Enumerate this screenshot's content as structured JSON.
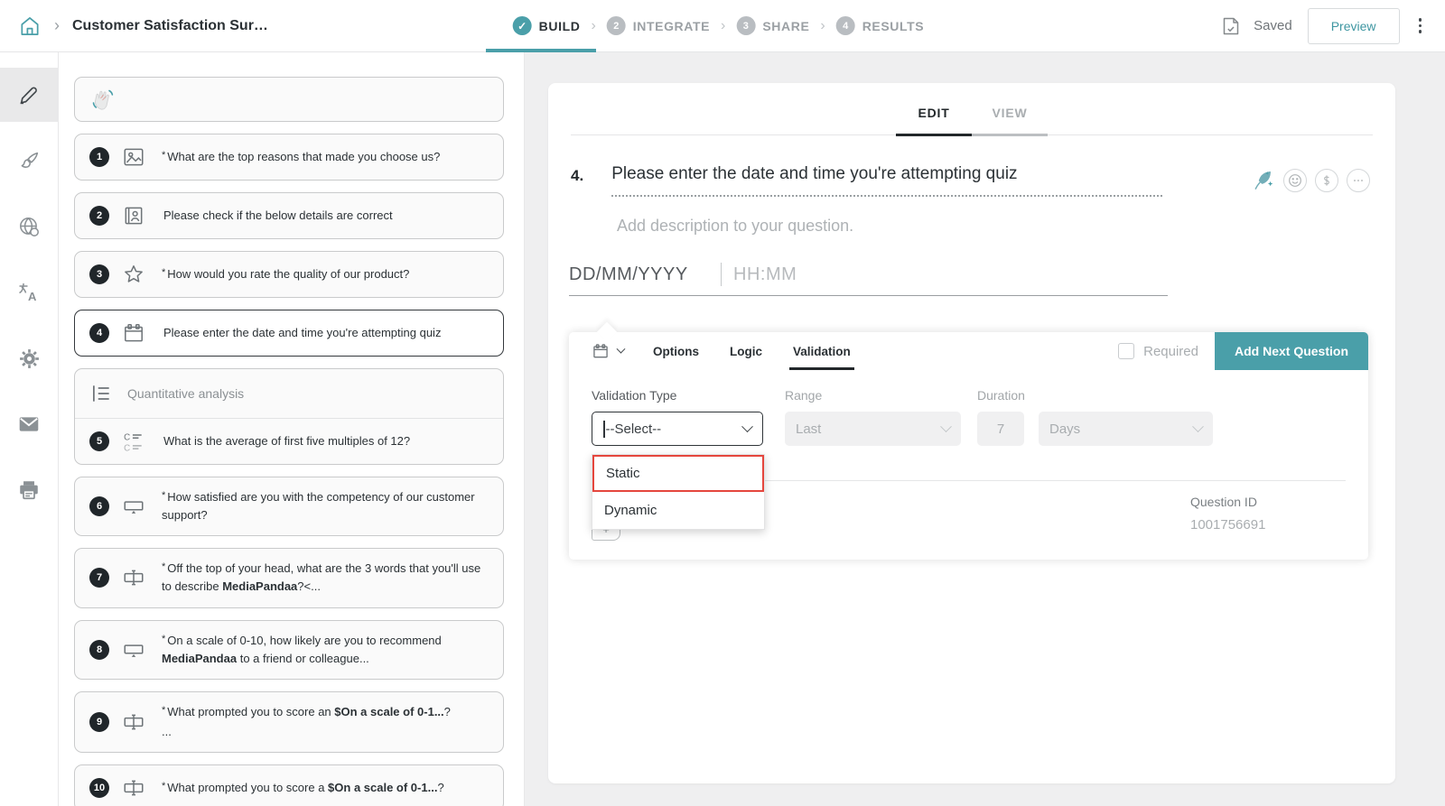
{
  "colors": {
    "accent": "#4A9FA9",
    "highlight_red": "#E5463D",
    "badge_dark": "#20262A"
  },
  "header": {
    "title": "Customer Satisfaction Sur…",
    "steps": [
      {
        "label": "BUILD",
        "state": "done",
        "icon": "check-icon"
      },
      {
        "num": "2",
        "label": "INTEGRATE"
      },
      {
        "num": "3",
        "label": "SHARE"
      },
      {
        "num": "4",
        "label": "RESULTS"
      }
    ],
    "saved_label": "Saved",
    "preview_label": "Preview"
  },
  "rail": {
    "items": [
      {
        "icon": "pencil-icon",
        "active": true
      },
      {
        "icon": "brush-icon"
      },
      {
        "icon": "globe-icon"
      },
      {
        "icon": "translate-icon"
      },
      {
        "icon": "gear-icon"
      },
      {
        "icon": "mail-icon"
      },
      {
        "icon": "printer-icon"
      }
    ]
  },
  "question_list": {
    "welcome_icon": "wave-icon",
    "group_label": "Quantitative analysis",
    "items": [
      {
        "num": "1",
        "icon": "image-icon",
        "ast": "*",
        "pre": "What are the top reasons that made you choose us?"
      },
      {
        "num": "2",
        "icon": "contact-icon",
        "ast": "",
        "pre": "Please check if the below details are correct"
      },
      {
        "num": "3",
        "icon": "star-icon",
        "ast": "*",
        "pre": "How would you rate the quality of our product?"
      },
      {
        "num": "4",
        "icon": "calendar-icon",
        "ast": "",
        "pre": "Please enter the date and time you're attempting quiz"
      },
      {
        "num": "5",
        "icon": "matrix-icon",
        "ast": "",
        "pre": "What is the average of first five multiples of 12?"
      },
      {
        "num": "6",
        "icon": "slider-icon",
        "ast": "*",
        "pre": "How satisfied are you with the competency of our customer support?"
      },
      {
        "num": "7",
        "icon": "textbox-icon",
        "ast": "*",
        "pre": "Off the top of your head, what are the 3 words that you'll use to describe ",
        "bold": "MediaPandaa",
        "post": "?<..."
      },
      {
        "num": "8",
        "icon": "slider-icon",
        "ast": "*",
        "pre": "On a scale of 0-10, how likely are you to recommend ",
        "bold": "MediaPandaa",
        "post": " to a friend or colleague..."
      },
      {
        "num": "9",
        "icon": "textbox-icon",
        "ast": "*",
        "pre": "What prompted you to score an ",
        "bold": "$On a scale of 0-1...",
        "post": "?",
        "line2": "..."
      },
      {
        "num": "10",
        "icon": "textbox-icon",
        "ast": "*",
        "pre": "What prompted you to score a ",
        "bold": "$On a scale of 0-1...",
        "post": "?"
      }
    ]
  },
  "editor": {
    "tabs": {
      "edit": "EDIT",
      "view": "VIEW"
    },
    "question_number": "4.",
    "question_title": "Please enter the date and time you're attempting quiz",
    "description_placeholder": "Add description to your question.",
    "date_placeholder": "DD/MM/YYYY",
    "time_placeholder": "HH:MM",
    "action_icons": [
      "quill-ai-icon",
      "smiley-icon",
      "dollar-icon",
      "more-icon"
    ],
    "panel": {
      "type_icon": "calendar-icon",
      "tabs": {
        "options": "Options",
        "logic": "Logic",
        "validation": "Validation"
      },
      "active_tab": "Validation",
      "required_label": "Required",
      "add_next_label": "Add Next Question",
      "fields": {
        "validation_type_label": "Validation Type",
        "validation_type_value": "--Select--",
        "range_label": "Range",
        "range_value": "Last",
        "duration_label": "Duration",
        "duration_value": "7",
        "duration_unit": "Days"
      },
      "dropdown": {
        "options": [
          "Static",
          "Dynamic"
        ],
        "highlighted": "Static"
      },
      "question_id_label": "Question ID",
      "question_id_value": "1001756691"
    }
  }
}
